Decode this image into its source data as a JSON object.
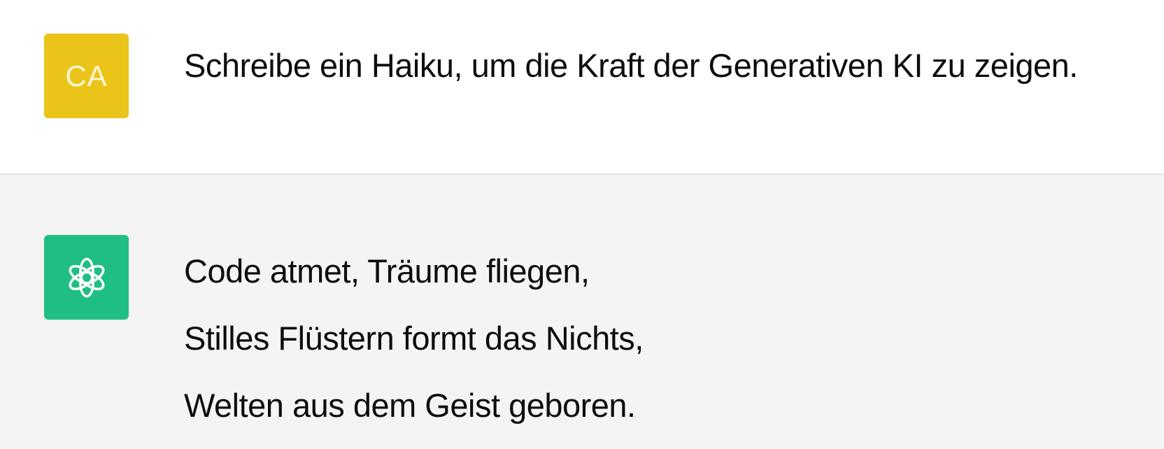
{
  "user_message": {
    "avatar_initials": "CA",
    "avatar_color": "#ebc41a",
    "text": "Schreibe ein Haiku, um die Kraft der Generativen KI zu zeigen."
  },
  "assistant_message": {
    "avatar_icon": "openai-logo-icon",
    "avatar_color": "#1fbf83",
    "lines": [
      "Code atmet, Träume fliegen,",
      "Stilles Flüstern formt das Nichts,",
      "Welten aus dem Geist geboren."
    ]
  }
}
